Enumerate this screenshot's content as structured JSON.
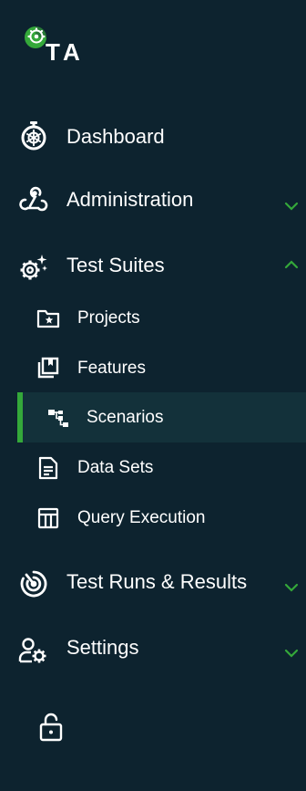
{
  "brand": {
    "logo_text": "TA",
    "accent_color": "#34a83a",
    "background_color": "#0d232f"
  },
  "nav": {
    "dashboard": {
      "label": "Dashboard",
      "icon": "stopwatch-icon"
    },
    "administration": {
      "label": "Administration",
      "icon": "webhook-icon",
      "expanded": false
    },
    "test_suites": {
      "label": "Test Suites",
      "icon": "gears-sparkle-icon",
      "expanded": true,
      "children": {
        "projects": {
          "label": "Projects",
          "icon": "folder-star-icon"
        },
        "features": {
          "label": "Features",
          "icon": "bookmark-library-icon"
        },
        "scenarios": {
          "label": "Scenarios",
          "icon": "tree-structure-icon",
          "active": true
        },
        "data_sets": {
          "label": "Data Sets",
          "icon": "document-lines-icon"
        },
        "query_execution": {
          "label": "Query Execution",
          "icon": "table-layout-icon"
        }
      }
    },
    "test_runs": {
      "label": "Test Runs & Results",
      "icon": "radar-icon",
      "expanded": false
    },
    "settings": {
      "label": "Settings",
      "icon": "user-gear-icon",
      "expanded": false
    }
  },
  "footer": {
    "lock_icon": "unlock-icon"
  }
}
